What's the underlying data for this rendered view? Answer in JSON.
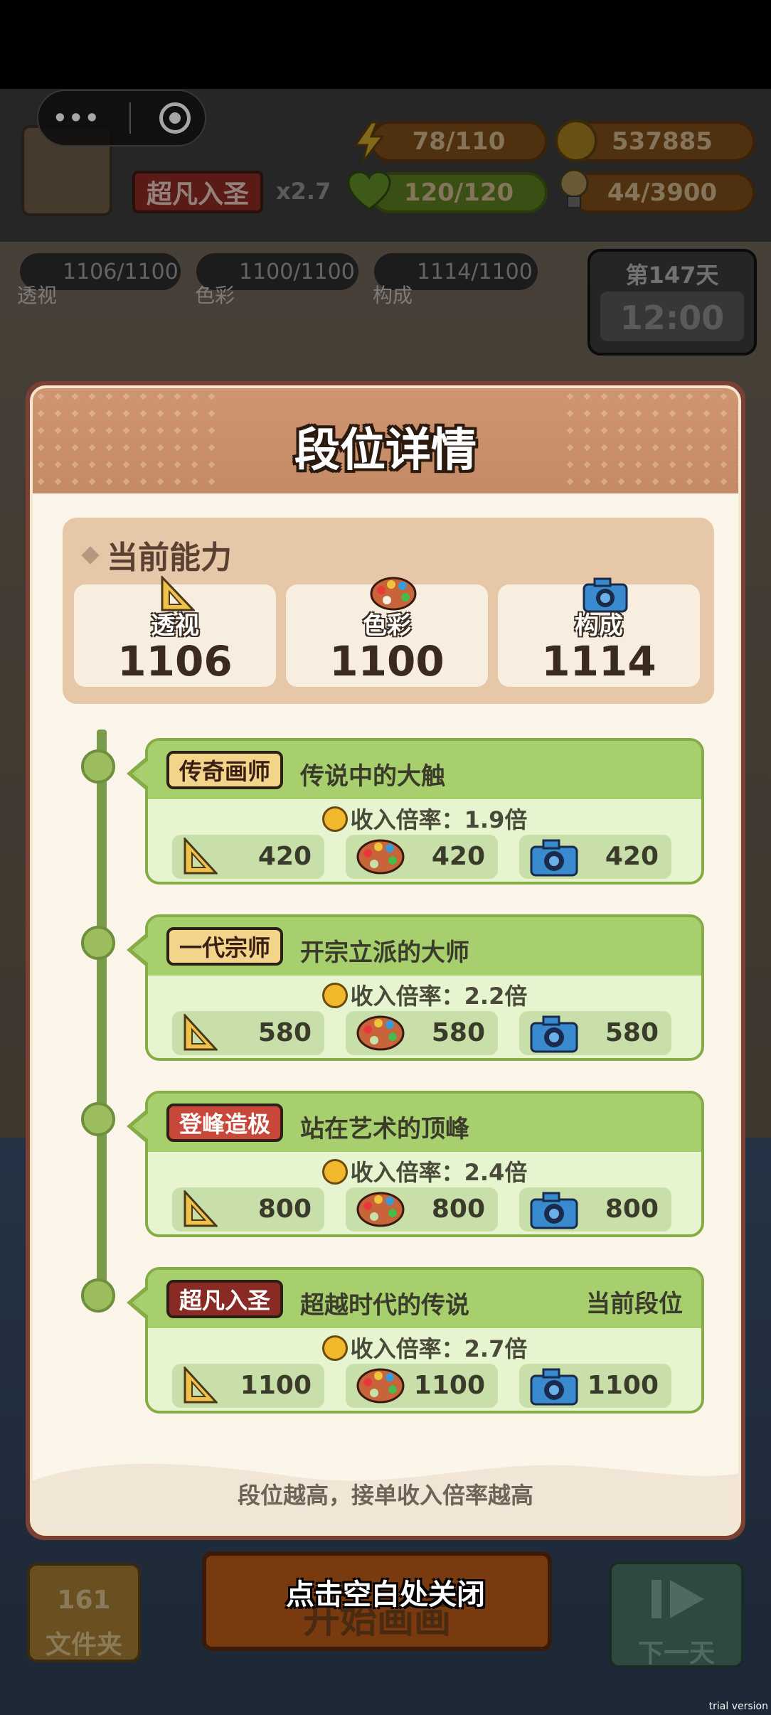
{
  "hud": {
    "rank_badge": "超凡入圣",
    "multiplier": "x2.7",
    "energy": "78/110",
    "coins": "537885",
    "health": "120/120",
    "ideas": "44/3900",
    "stats": [
      {
        "label": "透视",
        "value": "1106/1100"
      },
      {
        "label": "色彩",
        "value": "1100/1100"
      },
      {
        "label": "构成",
        "value": "1114/1100"
      }
    ],
    "day": "第147天",
    "time": "12:00"
  },
  "modal": {
    "title": "段位详情",
    "ability_title": "当前能力",
    "abilities": [
      {
        "label": "透视",
        "value": "1106",
        "icon": "ruler-icon"
      },
      {
        "label": "色彩",
        "value": "1100",
        "icon": "palette-icon"
      },
      {
        "label": "构成",
        "value": "1114",
        "icon": "camera-icon"
      }
    ],
    "ranks": [
      {
        "name": "传奇画师",
        "desc": "传说中的大触",
        "mult": "收入倍率：1.9倍",
        "req": [
          "420",
          "420",
          "420"
        ],
        "badge_color": "#f2d48a",
        "text_color": "#3b1f14"
      },
      {
        "name": "一代宗师",
        "desc": "开宗立派的大师",
        "mult": "收入倍率：2.2倍",
        "req": [
          "580",
          "580",
          "580"
        ],
        "badge_color": "#f2d48a",
        "text_color": "#3b1f14"
      },
      {
        "name": "登峰造极",
        "desc": "站在艺术的顶峰",
        "mult": "收入倍率：2.4倍",
        "req": [
          "800",
          "800",
          "800"
        ],
        "badge_color": "#c8463a",
        "text_color": "#ffffff"
      },
      {
        "name": "超凡入圣",
        "desc": "超越时代的传说",
        "mult": "收入倍率：2.7倍",
        "req": [
          "1100",
          "1100",
          "1100"
        ],
        "badge_color": "#8a2a24",
        "text_color": "#ffffff",
        "current": "当前段位"
      }
    ],
    "hint": "段位越高，接单收入倍率越高"
  },
  "bottom": {
    "close_hint": "点击空白处关闭",
    "folder_count": "161",
    "folder_label": "文件夹",
    "start_label": "开始画画",
    "next_label": "下一天"
  },
  "watermark": "trial version"
}
